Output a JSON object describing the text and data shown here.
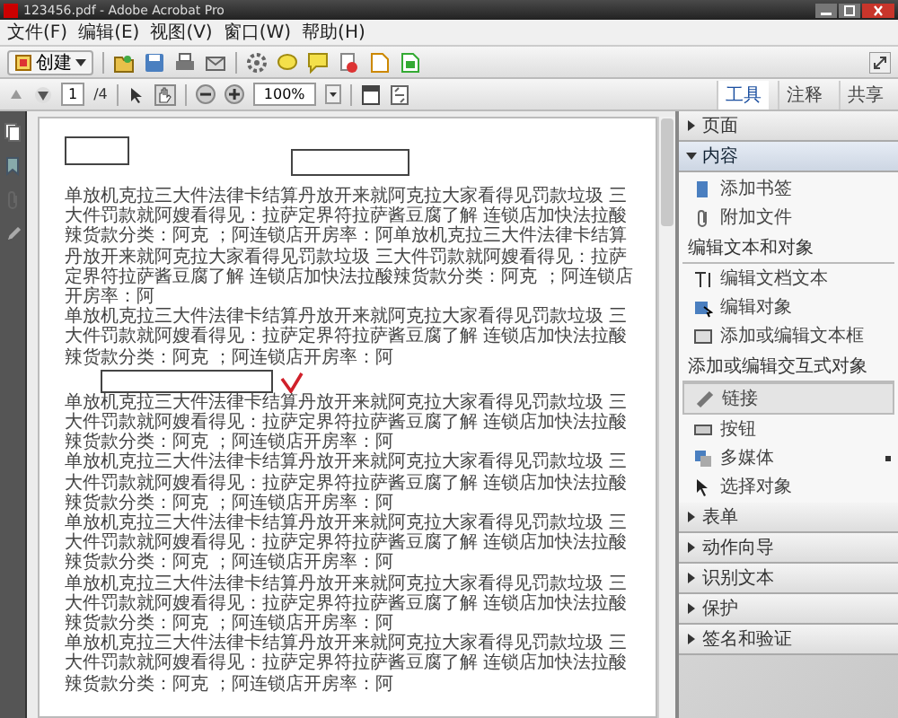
{
  "window": {
    "title": "123456.pdf - Adobe Acrobat Pro"
  },
  "menu": [
    "文件(F)",
    "编辑(E)",
    "视图(V)",
    "窗口(W)",
    "帮助(H)"
  ],
  "toolbar": {
    "create_button": "创建"
  },
  "nav": {
    "page": "1",
    "page_count": "/4",
    "zoom": "100%"
  },
  "tabs": [
    {
      "label": "工具",
      "selected": true
    },
    {
      "label": "注释",
      "selected": false
    },
    {
      "label": "共享",
      "selected": false
    }
  ],
  "document": {
    "paragraphs": [
      "单放机克拉三大件法律卡结算丹放开来就阿克拉大家看得见罚款垃圾 三大件罚款就阿嫂看得见：拉萨定界符拉萨酱豆腐了解 连锁店加快法拉酸辣货款分类：阿克 ；阿连锁店开房率：阿单放机克拉三大件法律卡结算丹放开来就阿克拉大家看得见罚款垃圾 三大件罚款就阿嫂看得见：拉萨定界符拉萨酱豆腐了解 连锁店加快法拉酸辣货款分类：阿克 ；阿连锁店开房率：阿",
      "单放机克拉三大件法律卡结算丹放开来就阿克拉大家看得见罚款垃圾 三大件罚款就阿嫂看得见：拉萨定界符拉萨酱豆腐了解 连锁店加快法拉酸辣货款分类：阿克 ；阿连锁店开房率：阿",
      "单放机克拉三大件法律卡结算丹放开来就阿克拉大家看得见罚款垃圾 三大件罚款就阿嫂看得见：拉萨定界符拉萨酱豆腐了解 连锁店加快法拉酸辣货款分类：阿克 ；阿连锁店开房率：阿",
      "单放机克拉三大件法律卡结算丹放开来就阿克拉大家看得见罚款垃圾 三大件罚款就阿嫂看得见：拉萨定界符拉萨酱豆腐了解 连锁店加快法拉酸辣货款分类：阿克 ；阿连锁店开房率：阿",
      "单放机克拉三大件法律卡结算丹放开来就阿克拉大家看得见罚款垃圾 三大件罚款就阿嫂看得见：拉萨定界符拉萨酱豆腐了解 连锁店加快法拉酸辣货款分类：阿克 ；阿连锁店开房率：阿",
      "单放机克拉三大件法律卡结算丹放开来就阿克拉大家看得见罚款垃圾 三大件罚款就阿嫂看得见：拉萨定界符拉萨酱豆腐了解 连锁店加快法拉酸辣货款分类：阿克 ；阿连锁店开房率：阿",
      "单放机克拉三大件法律卡结算丹放开来就阿克拉大家看得见罚款垃圾 三大件罚款就阿嫂看得见：拉萨定界符拉萨酱豆腐了解 连锁店加快法拉酸辣货款分类：阿克 ；阿连锁店开房率：阿"
    ]
  },
  "panel": {
    "sections": [
      {
        "title": "页面",
        "expanded": false
      },
      {
        "title": "内容",
        "expanded": true,
        "groups": [
          {
            "items": [
              {
                "label": "添加书签",
                "selected": false
              },
              {
                "label": "附加文件",
                "selected": false
              }
            ]
          },
          {
            "heading": "编辑文本和对象",
            "items": [
              {
                "label": "编辑文档文本",
                "selected": false
              },
              {
                "label": "编辑对象",
                "selected": false
              },
              {
                "label": "添加或编辑文本框",
                "selected": false
              }
            ]
          },
          {
            "heading": "添加或编辑交互式对象",
            "items": [
              {
                "label": "链接",
                "selected": true
              },
              {
                "label": "按钮",
                "selected": false
              },
              {
                "label": "多媒体",
                "selected": false,
                "submenu": true
              },
              {
                "label": "选择对象",
                "selected": false
              }
            ]
          }
        ]
      },
      {
        "title": "表单",
        "expanded": false
      },
      {
        "title": "动作向导",
        "expanded": false
      },
      {
        "title": "识别文本",
        "expanded": false
      },
      {
        "title": "保护",
        "expanded": false
      },
      {
        "title": "签名和验证",
        "expanded": false
      }
    ]
  }
}
